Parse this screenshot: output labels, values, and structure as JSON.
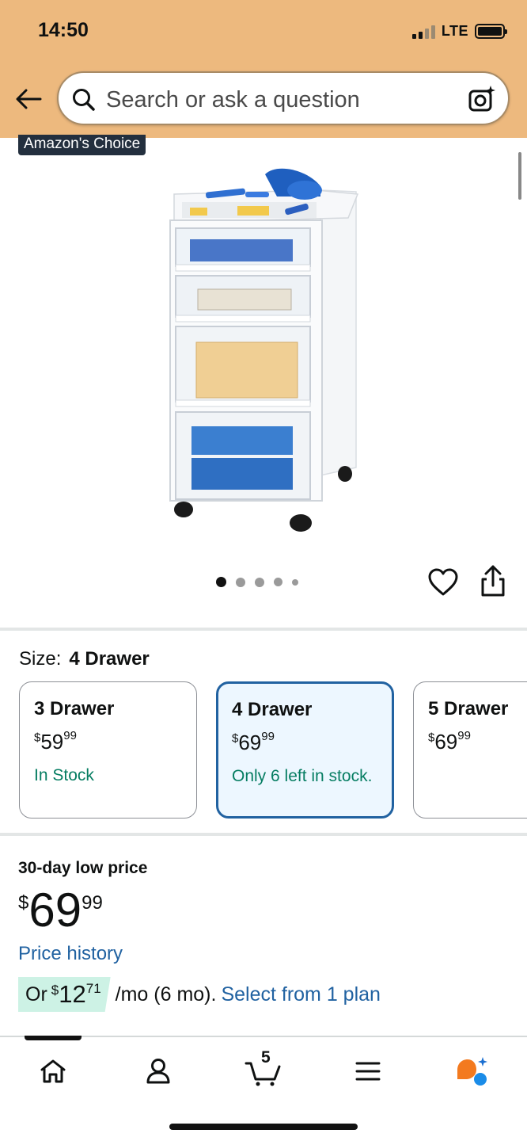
{
  "status_bar": {
    "time": "14:50",
    "network": "LTE"
  },
  "search": {
    "placeholder": "Search or ask a question"
  },
  "product": {
    "badge": "Amazon's Choice",
    "image_count": 5,
    "active_image_index": 0
  },
  "size": {
    "label": "Size:",
    "selected": "4 Drawer",
    "options": [
      {
        "name": "3 Drawer",
        "currency": "$",
        "whole": "59",
        "fraction": "99",
        "stock": "In Stock"
      },
      {
        "name": "4 Drawer",
        "currency": "$",
        "whole": "69",
        "fraction": "99",
        "stock": "Only 6 left in stock."
      },
      {
        "name": "5 Drawer",
        "currency": "$",
        "whole": "69",
        "fraction": "99",
        "stock": ""
      }
    ]
  },
  "price": {
    "low_label": "30-day low price",
    "currency": "$",
    "whole": "69",
    "fraction": "99",
    "history_link": "Price history",
    "monthly": {
      "prefix": "Or",
      "currency": "$",
      "whole": "12",
      "fraction": "71",
      "suffix": "/mo (6 mo).",
      "link": "Select from 1 plan"
    }
  },
  "bottom_nav": {
    "cart_count": "5",
    "items": [
      "home-icon",
      "account-icon",
      "cart-icon",
      "menu-icon",
      "rufus-icon"
    ]
  },
  "colors": {
    "header_bg": "#EDB97E",
    "link": "#2162a1",
    "in_stock": "#067d62",
    "selected_card_bg": "#edf7ff",
    "monthly_badge_bg": "#cdf2e5"
  }
}
